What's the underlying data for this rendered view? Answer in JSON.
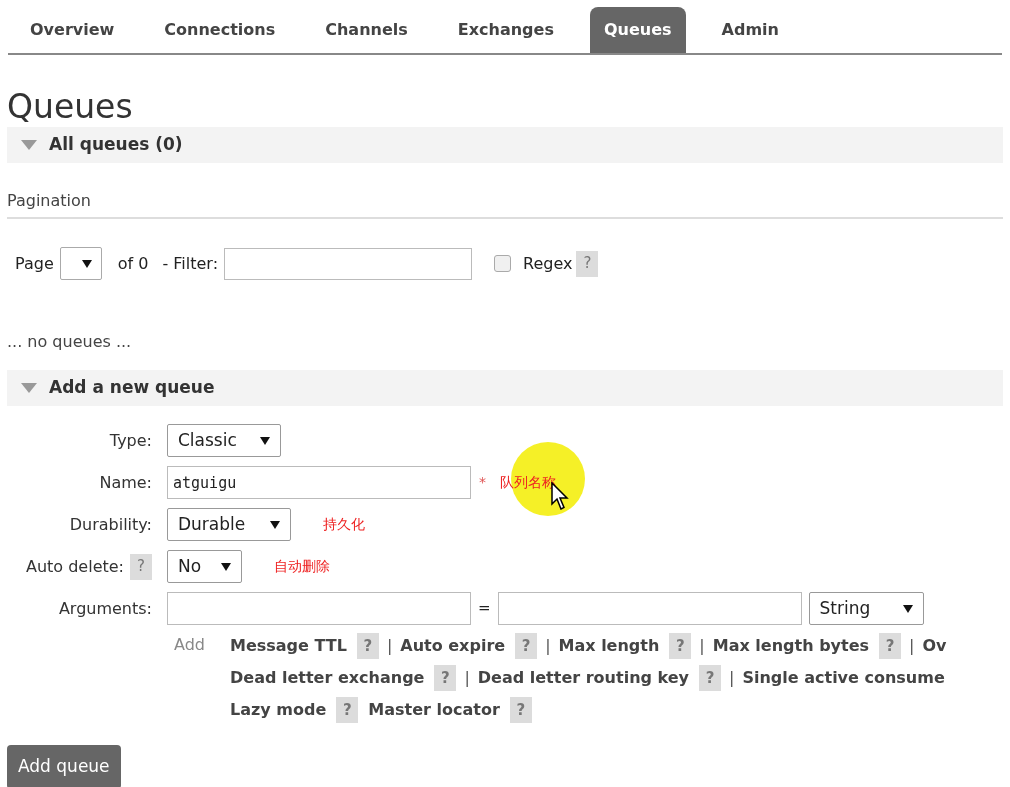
{
  "tabs": [
    {
      "label": "Overview",
      "selected": false
    },
    {
      "label": "Connections",
      "selected": false
    },
    {
      "label": "Channels",
      "selected": false
    },
    {
      "label": "Exchanges",
      "selected": false
    },
    {
      "label": "Queues",
      "selected": true
    },
    {
      "label": "Admin",
      "selected": false
    }
  ],
  "page_title": "Queues",
  "all_queues": {
    "title": "All queues (0)",
    "expanded": true
  },
  "pagination": {
    "heading": "Pagination",
    "page_label": "Page",
    "of_text": "of 0",
    "filter_label": "- Filter:",
    "regex": {
      "label": "Regex",
      "checked": false,
      "help": "?"
    }
  },
  "empty_message": "... no queues ...",
  "add_queue": {
    "title": "Add a new queue",
    "expanded": true,
    "fields": [
      {
        "kind": "select",
        "label": "Type:",
        "value": "Classic"
      },
      {
        "kind": "text",
        "label": "Name:",
        "value": "atguigu",
        "required_mark": "*",
        "note": "队列名称"
      },
      {
        "kind": "select",
        "label": "Durability:",
        "value": "Durable",
        "note": "持久化"
      },
      {
        "kind": "select",
        "label": "Auto delete:",
        "help": "?",
        "value": "No",
        "note": "自动删除"
      },
      {
        "kind": "arguments",
        "label": "Arguments:",
        "equals": "=",
        "type_value": "String"
      }
    ],
    "add_label": "Add",
    "shortcut_rows": [
      [
        {
          "label": "Message TTL",
          "help": "?",
          "separator": "|"
        },
        {
          "label": "Auto expire",
          "help": "?",
          "separator": "|"
        },
        {
          "label": "Max length",
          "help": "?",
          "separator": "|"
        },
        {
          "label": "Max length bytes",
          "help": "?",
          "separator": "|"
        },
        {
          "label": "Ov"
        }
      ],
      [
        {
          "label": "Dead letter exchange",
          "help": "?",
          "separator": "|"
        },
        {
          "label": "Dead letter routing key",
          "help": "?",
          "separator": "|"
        },
        {
          "label": "Single active consume"
        }
      ],
      [
        {
          "label": "Lazy mode",
          "help": "?"
        },
        {
          "label": "Master locator",
          "help": "?"
        }
      ]
    ],
    "submit": "Add queue"
  }
}
